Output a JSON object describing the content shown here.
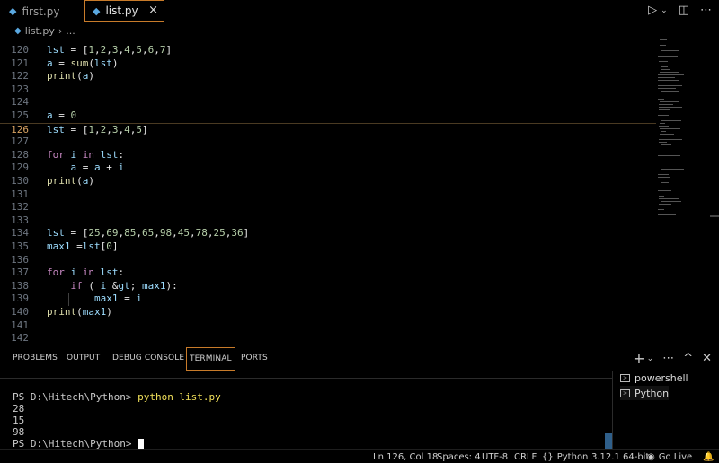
{
  "tabs": [
    {
      "label": "first.py",
      "active": false
    },
    {
      "label": "list.py",
      "active": true
    }
  ],
  "tab_close_icon": "×",
  "toolbar_icons": [
    "run-icon",
    "chevron-down-icon",
    "split-editor-icon",
    "more-icon"
  ],
  "breadcrumb": {
    "file": "list.py",
    "rest": "..."
  },
  "editor": {
    "active_line": 126,
    "lines": [
      {
        "n": "120",
        "code": "lst = [1,2,3,4,5,6,7]"
      },
      {
        "n": "121",
        "code": "a = sum(lst)"
      },
      {
        "n": "122",
        "code": "print(a)"
      },
      {
        "n": "123",
        "code": ""
      },
      {
        "n": "124",
        "code": ""
      },
      {
        "n": "125",
        "code": "a = 0"
      },
      {
        "n": "126",
        "code": "lst = [1,2,3,4,5]"
      },
      {
        "n": "127",
        "code": ""
      },
      {
        "n": "128",
        "code": "for i in lst:"
      },
      {
        "n": "129",
        "code": "    a = a + i"
      },
      {
        "n": "130",
        "code": "print(a)"
      },
      {
        "n": "131",
        "code": ""
      },
      {
        "n": "132",
        "code": ""
      },
      {
        "n": "133",
        "code": ""
      },
      {
        "n": "134",
        "code": "lst = [25,69,85,65,98,45,78,25,36]"
      },
      {
        "n": "135",
        "code": "max1 =lst[0]"
      },
      {
        "n": "136",
        "code": ""
      },
      {
        "n": "137",
        "code": "for i in lst:"
      },
      {
        "n": "138",
        "code": "    if ( i > max1):"
      },
      {
        "n": "139",
        "code": "        max1 = i"
      },
      {
        "n": "140",
        "code": "print(max1)"
      },
      {
        "n": "141",
        "code": ""
      },
      {
        "n": "142",
        "code": ""
      }
    ]
  },
  "panel": {
    "tabs": [
      "PROBLEMS",
      "OUTPUT",
      "DEBUG CONSOLE",
      "TERMINAL",
      "PORTS"
    ],
    "active_tab": "TERMINAL",
    "terminal_lines": [
      {
        "prompt": "PS D:\\Hitech\\Python> ",
        "cmd": "python list.py"
      },
      {
        "prompt": "28",
        "cmd": ""
      },
      {
        "prompt": "15",
        "cmd": ""
      },
      {
        "prompt": "98",
        "cmd": ""
      },
      {
        "prompt": "PS D:\\Hitech\\Python> ",
        "cmd": ""
      }
    ],
    "terminals": [
      {
        "label": "powershell"
      },
      {
        "label": "Python"
      }
    ]
  },
  "status": {
    "position": "Ln 126, Col 18",
    "spaces": "Spaces: 4",
    "encoding": "UTF-8",
    "eol": "CRLF",
    "language": "Python",
    "interpreter": "3.12.1 64-bit",
    "golive": "Go Live"
  },
  "colors": {
    "accent": "#c87b2a",
    "keyword": "#c586c0",
    "function": "#dcdcaa",
    "number": "#b5cea8",
    "variable": "#9cdcfe"
  }
}
